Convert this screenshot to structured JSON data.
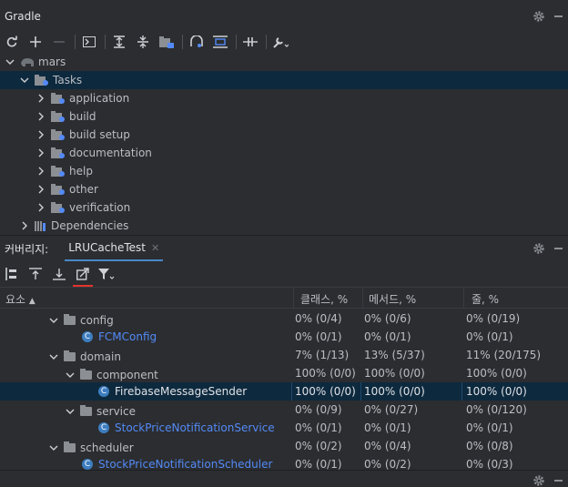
{
  "gradle_panel": {
    "title": "Gradle",
    "toolbar": [
      "refresh-icon",
      "add-icon",
      "remove-icon",
      "run-icon",
      "expand-all-icon",
      "collapse-all-icon",
      "group-icon",
      "analyze-icon",
      "dependencies-icon",
      "offline-icon",
      "settings-wrench-icon"
    ],
    "tree": [
      {
        "label": "mars",
        "level": 0,
        "expanded": true,
        "icon": "elephant-icon"
      },
      {
        "label": "Tasks",
        "level": 1,
        "expanded": true,
        "icon": "folder-gear-icon",
        "selected": true
      },
      {
        "label": "application",
        "level": 2,
        "expanded": false,
        "icon": "folder-gear-icon"
      },
      {
        "label": "build",
        "level": 2,
        "expanded": false,
        "icon": "folder-gear-icon"
      },
      {
        "label": "build setup",
        "level": 2,
        "expanded": false,
        "icon": "folder-gear-icon"
      },
      {
        "label": "documentation",
        "level": 2,
        "expanded": false,
        "icon": "folder-gear-icon"
      },
      {
        "label": "help",
        "level": 2,
        "expanded": false,
        "icon": "folder-gear-icon"
      },
      {
        "label": "other",
        "level": 2,
        "expanded": false,
        "icon": "folder-gear-icon"
      },
      {
        "label": "verification",
        "level": 2,
        "expanded": false,
        "icon": "folder-gear-icon"
      },
      {
        "label": "Dependencies",
        "level": 1,
        "expanded": false,
        "icon": "library-icon"
      }
    ]
  },
  "coverage_panel": {
    "label": "커버리지:",
    "tab": "LRUCacheTest",
    "columns": [
      "요소",
      "클래스, %",
      "메서드, %",
      "줄, %"
    ],
    "rows": [
      {
        "name": "config",
        "level": 1,
        "type": "package",
        "expanded": true,
        "class": "0% (0/4)",
        "method": "0% (0/6)",
        "line": "0% (0/19)"
      },
      {
        "name": "FCMConfig",
        "level": 2,
        "type": "class",
        "class": "0% (0/1)",
        "method": "0% (0/1)",
        "line": "0% (0/1)"
      },
      {
        "name": "domain",
        "level": 1,
        "type": "package",
        "expanded": true,
        "class": "7% (1/13)",
        "method": "13% (5/37)",
        "line": "11% (20/175)"
      },
      {
        "name": "component",
        "level": 2,
        "type": "package",
        "expanded": true,
        "class": "100% (0/0)",
        "method": "100% (0/0)",
        "line": "100% (0/0)"
      },
      {
        "name": "FirebaseMessageSender",
        "level": 3,
        "type": "class",
        "selected": true,
        "class": "100% (0/0)",
        "method": "100% (0/0)",
        "line": "100% (0/0)"
      },
      {
        "name": "service",
        "level": 2,
        "type": "package",
        "expanded": true,
        "class": "0% (0/9)",
        "method": "0% (0/27)",
        "line": "0% (0/120)"
      },
      {
        "name": "StockPriceNotificationService",
        "level": 3,
        "type": "class",
        "class": "0% (0/1)",
        "method": "0% (0/1)",
        "line": "0% (0/1)"
      },
      {
        "name": "scheduler",
        "level": 1,
        "type": "package",
        "expanded": true,
        "class": "0% (0/2)",
        "method": "0% (0/4)",
        "line": "0% (0/8)"
      },
      {
        "name": "StockPriceNotificationScheduler",
        "level": 2,
        "type": "class",
        "class": "0% (0/1)",
        "method": "0% (0/2)",
        "line": "0% (0/3)"
      }
    ]
  }
}
